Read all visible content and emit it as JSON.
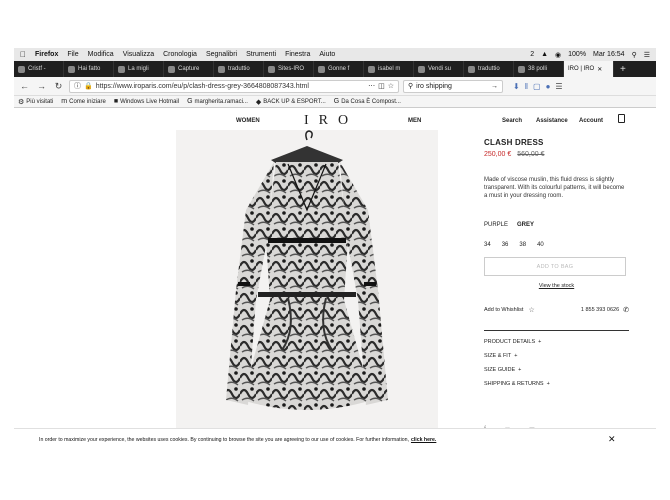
{
  "menubar": {
    "apple": "",
    "app": "Firefox",
    "items": [
      "File",
      "Modifica",
      "Visualizza",
      "Cronologia",
      "Segnalibri",
      "Strumenti",
      "Finestra",
      "Aiuto"
    ],
    "status_num": "2",
    "battery": "100%",
    "clock": "Mar 16:54"
  },
  "tabs": [
    {
      "label": "Cristf -"
    },
    {
      "label": "Hai fatto"
    },
    {
      "label": "La migli"
    },
    {
      "label": "Capture"
    },
    {
      "label": "traduttio"
    },
    {
      "label": "Sites-IRO"
    },
    {
      "label": "Gonne f"
    },
    {
      "label": "isabel m"
    },
    {
      "label": "Vendi su"
    },
    {
      "label": "traduttio"
    },
    {
      "label": "38 polli"
    },
    {
      "label": "IRO | IRO"
    }
  ],
  "navbar": {
    "url": "https://www.iroparis.com/eu/p/clash-dress-grey-3664808087343.html",
    "search_value": "iro shipping"
  },
  "bookmarks": [
    {
      "label": "Più visitati"
    },
    {
      "label": "Come iniziare"
    },
    {
      "label": "Windows Live Hotmail"
    },
    {
      "label": "margherita.ramaci..."
    },
    {
      "label": "BACK UP & ESPORT..."
    },
    {
      "label": "Da Cosa È Compost..."
    }
  ],
  "site": {
    "women": "WOMEN",
    "logo": "IRO",
    "men": "MEN",
    "search": "Search",
    "assistance": "Assistance",
    "account": "Account"
  },
  "product": {
    "title": "CLASH DRESS",
    "price_new": "250,00 €",
    "price_old": "560,00 €",
    "description": "Made of viscose muslin, this fluid dress is slightly transparent. With its colourful patterns, it will become a must in your dressing room.",
    "colors": [
      "PURPLE",
      "GREY"
    ],
    "selected_color": "GREY",
    "sizes": [
      "34",
      "36",
      "38",
      "40"
    ],
    "add_to_bag": "ADD TO BAG",
    "view_stock": "View the stock",
    "wishlist": "Add to Whishlist",
    "phone": "1 855 393 0626",
    "accordions": [
      "PRODUCT DETAILS",
      "SIZE & FIT",
      "SIZE GUIDE",
      "SHIPPING & RETURNS"
    ]
  },
  "cookie": {
    "text": "In order to maximize your experience, the websites uses cookies. By continuing to browse the site you are agreeing to our use of cookies. For further information,",
    "link": "click here."
  },
  "colors": {
    "price_red": "#c62828",
    "tabbar_dark": "#1f1f1f",
    "link_blue": "#4a6fb5"
  }
}
